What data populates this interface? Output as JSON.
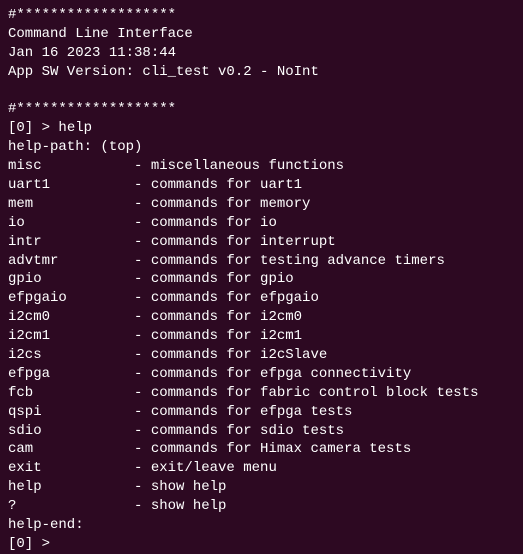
{
  "header": {
    "separator_top": "#*******************",
    "title": "Command Line Interface",
    "datetime": "Jan 16 2023 11:38:44",
    "version_line": "App SW Version: cli_test v0.2 - NoInt",
    "separator_bottom": "#*******************"
  },
  "session": {
    "prompt_prefix": "[0] > ",
    "first_command": "help",
    "help_path_label": "help-path: (top)",
    "help_end_label": "help-end:",
    "final_prompt": "[0] > "
  },
  "help": {
    "items": [
      {
        "name": "misc",
        "desc": "miscellaneous functions"
      },
      {
        "name": "uart1",
        "desc": "commands for uart1"
      },
      {
        "name": "mem",
        "desc": "commands for memory"
      },
      {
        "name": "io",
        "desc": "commands for io"
      },
      {
        "name": "intr",
        "desc": "commands for interrupt"
      },
      {
        "name": "advtmr",
        "desc": "commands for testing advance timers"
      },
      {
        "name": "gpio",
        "desc": "commands for gpio"
      },
      {
        "name": "efpgaio",
        "desc": "commands for efpgaio"
      },
      {
        "name": "i2cm0",
        "desc": "commands for i2cm0"
      },
      {
        "name": "i2cm1",
        "desc": "commands for i2cm1"
      },
      {
        "name": "i2cs",
        "desc": "commands for i2cSlave"
      },
      {
        "name": "efpga",
        "desc": "commands for efpga connectivity"
      },
      {
        "name": "fcb",
        "desc": "commands for fabric control block tests"
      },
      {
        "name": "qspi",
        "desc": "commands for efpga tests"
      },
      {
        "name": "sdio",
        "desc": "commands for sdio tests"
      },
      {
        "name": "cam",
        "desc": "commands for Himax camera tests"
      },
      {
        "name": "exit",
        "desc": "exit/leave menu"
      },
      {
        "name": "help",
        "desc": "show help"
      },
      {
        "name": "?",
        "desc": "show help"
      }
    ]
  }
}
